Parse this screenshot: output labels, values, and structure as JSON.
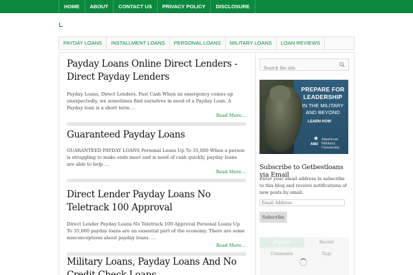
{
  "top_nav": [
    "HOME",
    "ABOUT",
    "CONTACT US",
    "PRIVACY POLICY",
    "DISCLOSURE"
  ],
  "category_nav": [
    "PAYDAY LOANS",
    "INSTALLMENT LOANS",
    "PERSONAL LOANS",
    "MILITARY LOANS",
    "LOAN REVIEWS"
  ],
  "posts": [
    {
      "title": "Payday Loans Online Direct Lenders - Direct Payday Lenders",
      "excerpt": " Payday Loans, Direct Lenders, Fast Cash When an emergency comes up unexpectedly, we sometimes find ourselves in need of a Payday Loan.  A Payday loan is a short term …",
      "read_more": "Read More..."
    },
    {
      "title": "Guaranteed Payday Loans",
      "excerpt": "GUARANTEED PAYDAY LOANS  Personal Loans Up To 35,000 When a person is struggling to make ends meet and is need of cash quickly, payday loans are able to help …",
      "read_more": "Read More..."
    },
    {
      "title": "Direct Lender Payday Loans No Teletrack 100 Approval",
      "excerpt": "Direct Lender Payday Loans No Teletrack  100 Approval Personal Loans Up To 35,000 payday loans are an essential part of the economy. There are some misconceptions about payday loans. …",
      "read_more": "Read More..."
    },
    {
      "title": "Military Loans, Payday Loans And No Credit Check Loans",
      "excerpt": "",
      "read_more": ""
    }
  ],
  "sidebar": {
    "search_placeholder": "Search the site",
    "ad": {
      "line1": "PREPARE FOR",
      "line2": "LEADERSHIP",
      "line3": "IN THE MILITARY",
      "line4": "AND BEYOND",
      "cta": "LEARN HOW",
      "logo_abbr": "AMU",
      "logo_name": "American Military University"
    },
    "subscribe": {
      "title": "Subscribe to Getbestloans via Email",
      "text": "Enter your email address to subscribe to this blog and receive notifications of new posts by email.",
      "email_placeholder": "Email Address",
      "button": "Subscribe"
    },
    "tabs": [
      "Popular",
      "Recent",
      "Comments",
      "Tags"
    ]
  },
  "colors": {
    "brand": "#0b8a3e",
    "rule": "#e6e6e6"
  }
}
